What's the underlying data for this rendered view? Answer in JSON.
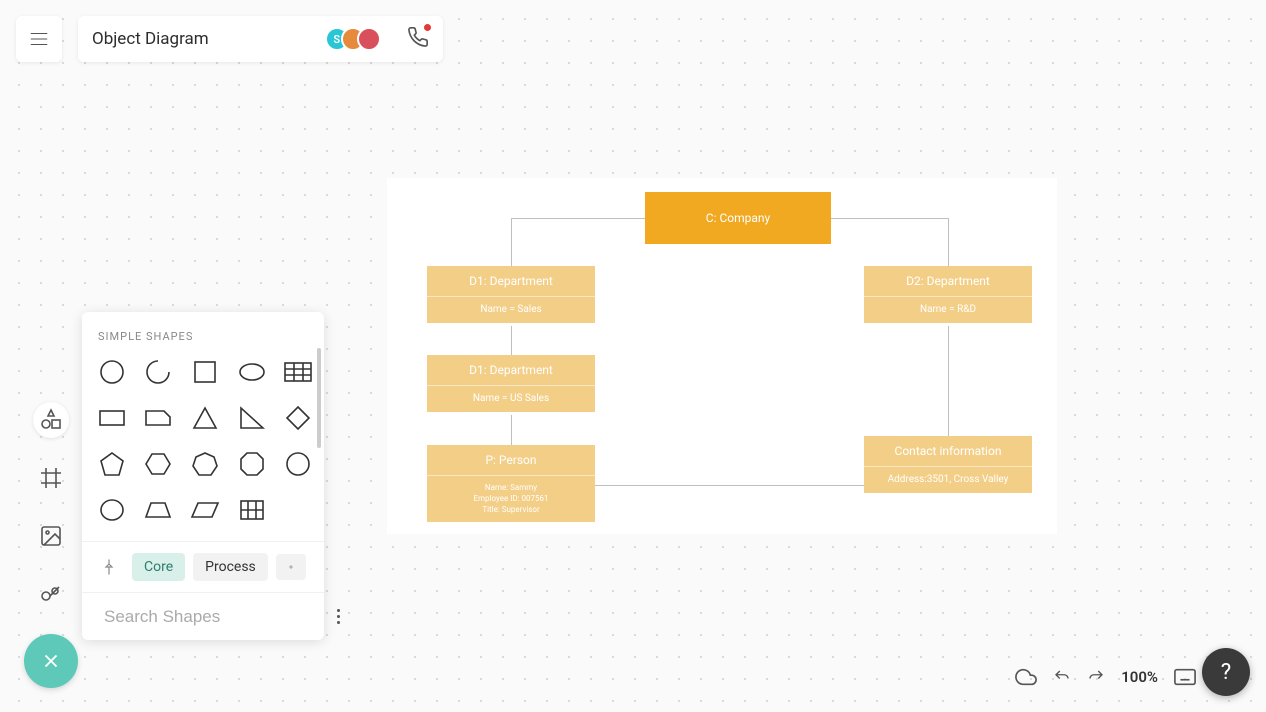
{
  "header": {
    "title": "Object Diagram",
    "avatars": [
      {
        "initial": "S"
      }
    ]
  },
  "shapes_panel": {
    "title": "SIMPLE SHAPES",
    "chips": {
      "core": "Core",
      "process": "Process"
    },
    "search_placeholder": "Search Shapes"
  },
  "diagram": {
    "company": {
      "title": "C: Company"
    },
    "d1": {
      "title": "D1: Department",
      "body": "Name = Sales"
    },
    "d2": {
      "title": "D2: Department",
      "body": "Name = R&D"
    },
    "d3": {
      "title": "D1: Department",
      "body": "Name = US Sales"
    },
    "person": {
      "title": "P: Person",
      "body": "Name: Sammy\nEmployee ID: 007561\nTitle: Supervisor"
    },
    "contact": {
      "title": "Contact information",
      "body": "Address:3501, Cross Valley"
    }
  },
  "footer": {
    "zoom": "100%",
    "help": "?"
  }
}
